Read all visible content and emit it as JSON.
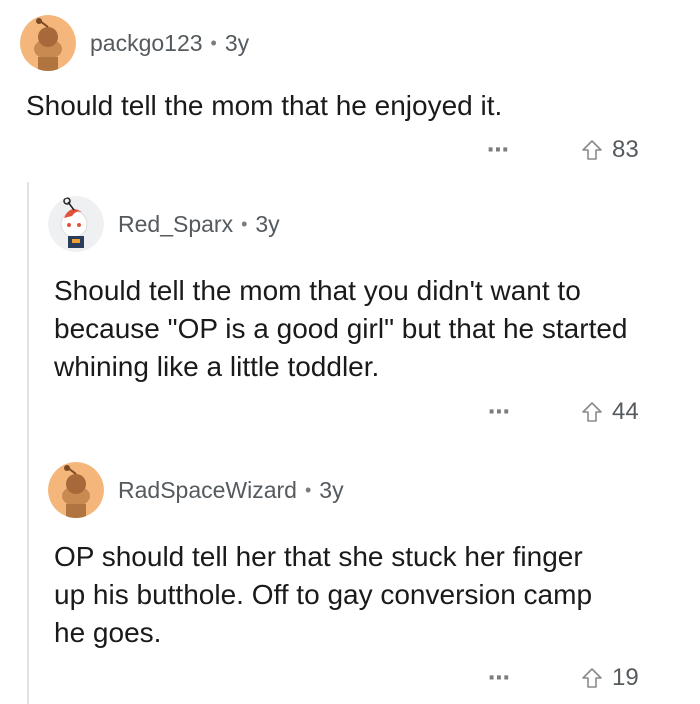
{
  "comments": [
    {
      "username": "packgo123",
      "separator": "•",
      "age": "3y",
      "text": "Should tell the mom that he enjoyed it.",
      "more_icon": "⋯",
      "upvotes": "83",
      "avatar_color": "#f4a460"
    },
    {
      "username": "Red_Sparx",
      "separator": "•",
      "age": "3y",
      "text": "Should tell the mom that you didn't want to because \"OP is a good girl\" but that he started whining like a little toddler.",
      "more_icon": "⋯",
      "upvotes": "44",
      "avatar_color": "#f0f0f0"
    },
    {
      "username": "RadSpaceWizard",
      "separator": "•",
      "age": "3y",
      "text": "OP should tell her that she stuck her finger up his butthole.  Off to gay conversion camp he goes.",
      "more_icon": "⋯",
      "upvotes": "19",
      "avatar_color": "#f4a460"
    }
  ],
  "icons": {
    "upvote": "arrow-up-icon",
    "more": "more-options-icon",
    "avatar": "snoo-avatar-icon"
  }
}
